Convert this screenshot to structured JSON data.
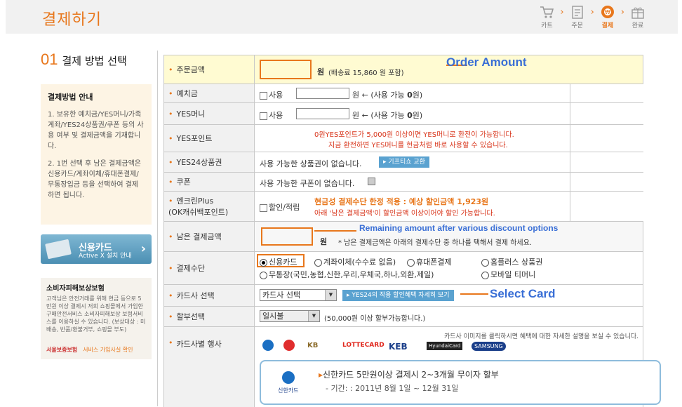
{
  "header": {
    "title": "결제하기",
    "steps": [
      {
        "label": "카트",
        "icon": "cart-icon",
        "active": false
      },
      {
        "label": "주문",
        "icon": "order-form-icon",
        "active": false
      },
      {
        "label": "결제",
        "icon": "payment-icon",
        "active": true
      },
      {
        "label": "완료",
        "icon": "gift-icon",
        "active": false
      }
    ]
  },
  "section": {
    "number": "01",
    "title": "결제 방법 선택"
  },
  "guide": {
    "title": "결제방법 안내",
    "p1": "1. 보유한 예치금/YES머니/가족계좌/YES24상품권/쿠폰 등의 사용 여부 및 결제금액을 기재합니다.",
    "p2": "2. 1번 선택 후 남은 결제금액은 신용카드/계좌이체/휴대폰결제/무통장입금 등을 선택하여 결제하면 됩니다."
  },
  "card_button": {
    "title": "신용카드",
    "sub": "Active X 설치 안내"
  },
  "insurance": {
    "title": "소비자피해보상보험",
    "body": "고객님은 안전거래를 위해 현금 등으로 5만원 이상 결제시 저희 쇼핑몰에서 가입한 구매안전서비스 소비자피해보상 보험서비스를 이용하실 수 있습니다. (보상대상 : 미배송, 반품/환불거부, 쇼핑몰 부도)",
    "logo": "서울보증보험",
    "link": "서비스 가입사실 확인"
  },
  "rows": {
    "order_amount": {
      "label": "주문금액",
      "unit": "원",
      "note": "(배송료 15,860 원 포함)"
    },
    "deposit": {
      "label": "예치금",
      "check": "사용",
      "note": "원 ← (사용 가능 ",
      "avail": "0",
      "close": "원)"
    },
    "yesmoney": {
      "label": "YES머니",
      "check": "사용",
      "note": "원 ← (사용 가능 ",
      "avail": "0",
      "close": "원)"
    },
    "yespoint": {
      "label": "YES포인트",
      "line1": "0원YES포인트가 5,000원 이상이면 YES머니로 환전이 가능합니다.",
      "line2": "지금 환전하면 YES머니를 현금처럼 바로 사용할 수 있습니다."
    },
    "giftcard": {
      "label": "YES24상품권",
      "text": "사용 가능한 상품권이 없습니다.",
      "button": "기프티쇼 교환"
    },
    "coupon": {
      "label": "쿠폰",
      "text": "사용 가능한 쿠폰이 없습니다."
    },
    "encleanplus": {
      "label1": "엔크린Plus",
      "label2": "(OK캐쉬백포인트)",
      "check": "할인/적립",
      "line1": "현금성 결제수단 한정 적용 : 예상 할인금액 1,923원",
      "line2": "아래 '남은 결제금액'이 할인금액 이상이어야 할인 가능합니다."
    },
    "remaining": {
      "label": "남은 결제금액",
      "unit": "원",
      "note": "* 남은 결제금액은 아래의 결제수단 중 하나를 택해서 결제 하세요."
    },
    "method": {
      "label": "결제수단",
      "options": [
        "신용카드",
        "계좌이체(수수료 없음)",
        "휴대폰결제",
        "홈플러스 상품권",
        "무통장(국민,농협,신한,우리,우체국,하나,외환,제일)",
        "모바일 티머니"
      ],
      "selected": "신용카드"
    },
    "card_select": {
      "label": "카드사 선택",
      "value": "카드사 선택",
      "button": "YES24의 작용 할인혜택 자세히 보기"
    },
    "installment": {
      "label": "할부선택",
      "value": "일시불",
      "note": "(50,000원 이상 할부가능합니다.)"
    },
    "card_events": {
      "label": "카드사별 행사",
      "note": "카드사 이미지를 클릭하시면 혜택에 대한 자세한 설명을 보실 수 있습니다.",
      "logos": [
        "KB",
        "LOTTECARD",
        "KEB",
        "HyundaiCard",
        "SAMSUNG"
      ]
    }
  },
  "benefit": {
    "card": "신한카드",
    "line1": "신한카드 5만원이상 결제시 2~3개월 무이자 할부",
    "line2": "- 기간: : 2011년 8월 1일 ~ 12월 31일"
  },
  "annotations": {
    "order": "Order Amount",
    "remaining": "Remaining amount after various discount options",
    "select": "Select Card"
  },
  "colors": {
    "accent": "#e8771c",
    "annotation": "#3a6fd6",
    "highlight": "#fffbd2",
    "red": "#d8341a"
  }
}
